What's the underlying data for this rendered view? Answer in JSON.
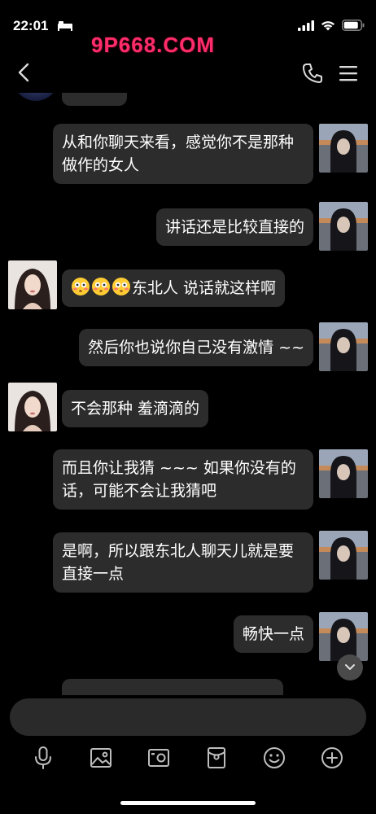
{
  "status_bar": {
    "time": "22:01"
  },
  "watermark": {
    "text": "9P668.COM"
  },
  "icons": {
    "back": "chevron-left-icon",
    "phone": "phone-icon",
    "menu": "hamburger-menu-icon",
    "scroll_down": "chevron-down-icon",
    "toolbar": [
      "microphone-icon",
      "image-icon",
      "camera-icon",
      "red-packet-icon",
      "smiley-icon",
      "plus-circle-icon"
    ]
  },
  "messages": [
    {
      "sender": "self",
      "text": "从和你聊天来看，感觉你不是那种做作的女人"
    },
    {
      "sender": "self",
      "text": "讲话还是比较直接的"
    },
    {
      "sender": "other",
      "emoji_count": 3,
      "emoji": "flushed-face-emoji",
      "text": "东北人 说话就这样啊"
    },
    {
      "sender": "self",
      "text": "然后你也说你自己没有激情 ~~"
    },
    {
      "sender": "other",
      "text": "不会那种 羞滴滴的"
    },
    {
      "sender": "self",
      "text": "而且你让我猜 ~~~ 如果你没有的话，可能不会让我猜吧"
    },
    {
      "sender": "self",
      "text": "是啊，所以跟东北人聊天儿就是要直接一点"
    },
    {
      "sender": "self",
      "text": "畅快一点"
    }
  ],
  "colors": {
    "background": "#000000",
    "bubble": "#2c2c2c",
    "watermark": "#ff2d6a",
    "input": "#2a2a2a"
  }
}
